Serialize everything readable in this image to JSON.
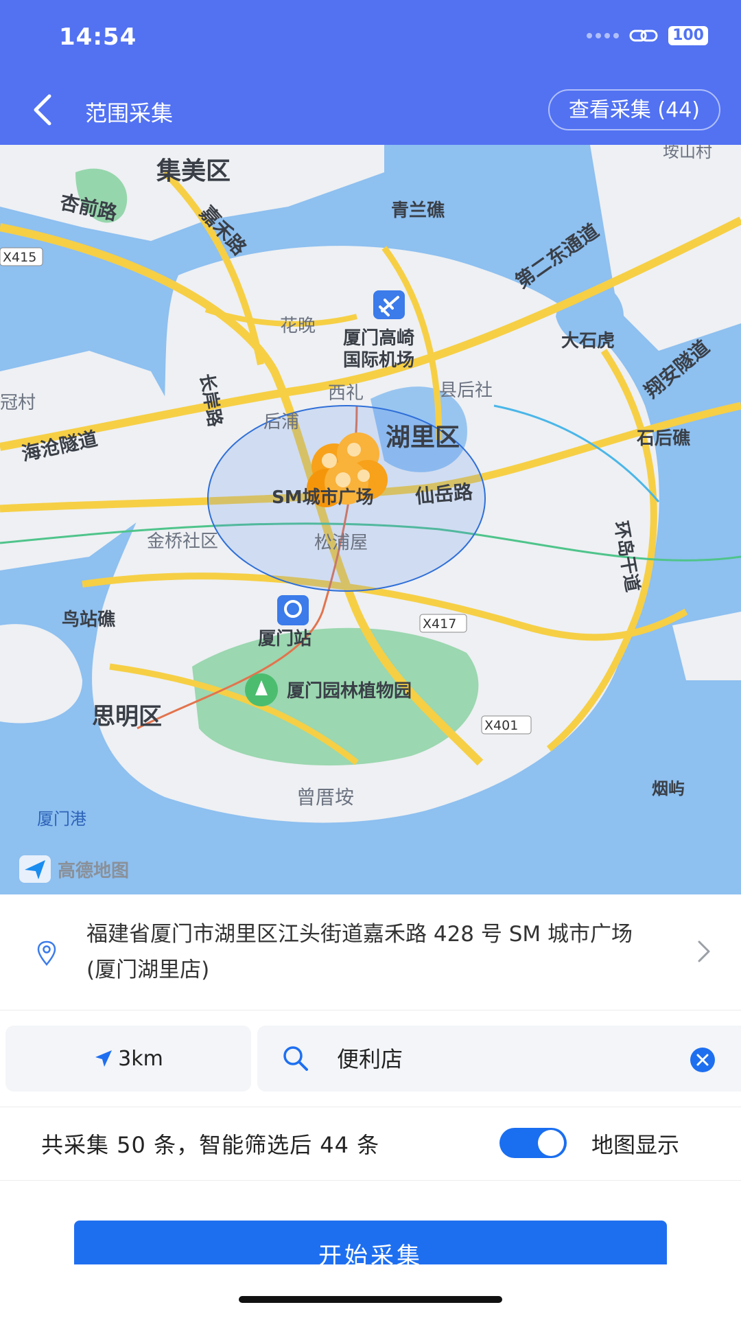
{
  "status_bar": {
    "time": "14:54",
    "battery": "100"
  },
  "nav": {
    "title": "范围采集",
    "view_button": "查看采集 (44)"
  },
  "map": {
    "labels": {
      "jimei": "集美区",
      "xingqian": "杏前路",
      "jiahe": "嘉禾路",
      "qinglan": "青兰礁",
      "second_east": "第二东通道",
      "x415": "X415",
      "huawan": "花晚",
      "airport_1": "厦门高崎",
      "airport_2": "国际机场",
      "dashihu": "大石虎",
      "xiangan": "翔安隧道",
      "guancun": "冠村",
      "haicang": "海沧隧道",
      "changan": "长岸路",
      "xili": "西礼",
      "xianhoushe": "县后社",
      "houpu": "后浦",
      "huli": "湖里区",
      "shihouji": "石后礁",
      "sm_plaza": "SM城市广场",
      "xianyue": "仙岳路",
      "jinqiao": "金桥社区",
      "songpu": "松浦屋",
      "huandao": "环岛干道",
      "x417": "X417",
      "niaozhan": "鸟站礁",
      "xiamen_station": "厦门站",
      "botanical": "厦门园林植物园",
      "siming": "思明区",
      "x401": "X401",
      "zengcuoan": "曾厝垵",
      "yanyu": "烟屿",
      "xiamen_port": "厦门港",
      "lingshancun": "垵山村",
      "amap": "高德地图"
    }
  },
  "address": {
    "text": "福建省厦门市湖里区江头街道嘉禾路 428 号 SM 城市广场 (厦门湖里店)"
  },
  "filter": {
    "range": "3km",
    "keyword": "便利店"
  },
  "summary": {
    "text": "共采集 50 条，智能筛选后 44 条",
    "map_toggle_label": "地图显示",
    "map_toggle_on": true
  },
  "actions": {
    "start_label": "开始采集"
  },
  "colors": {
    "header": "#5272f2",
    "accent": "#1e6ff0",
    "marker": "#f7a21a",
    "water": "#8ec0f0",
    "land": "#eef0f3",
    "park": "#7fcf9a"
  },
  "icons": [
    "back-arrow-icon",
    "location-pin-icon",
    "chevron-right-icon",
    "navigation-arrow-icon",
    "search-icon",
    "clear-icon",
    "airport-icon",
    "train-station-icon",
    "park-icon",
    "amap-logo-icon"
  ]
}
